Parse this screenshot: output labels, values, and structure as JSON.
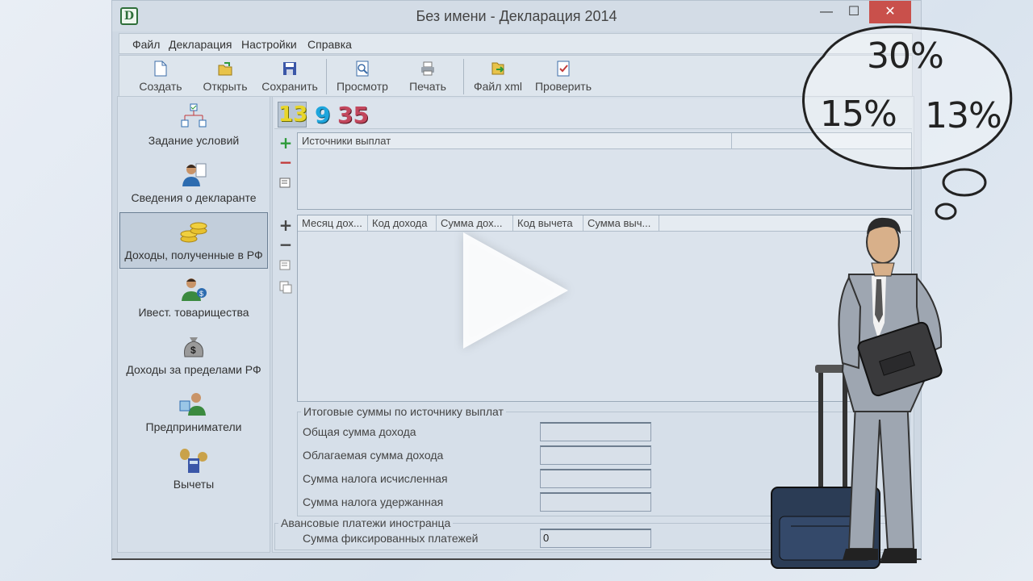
{
  "window": {
    "title": "Без имени - Декларация 2014",
    "app_icon": "D",
    "minimize": "—",
    "maximize": "☐",
    "close": "✕"
  },
  "menu": [
    "Файл",
    "Декларация",
    "Настройки",
    "Справка"
  ],
  "toolbar": [
    "Создать",
    "Открыть",
    "Сохранить",
    "Просмотр",
    "Печать",
    "Файл xml",
    "Проверить"
  ],
  "nav": [
    "Задание условий",
    "Сведения о декларанте",
    "Доходы, полученные в РФ",
    "Ивест. товарищества",
    "Доходы за пределами РФ",
    "Предприниматели",
    "Вычеты"
  ],
  "rates": [
    "13",
    "9",
    "35"
  ],
  "sources_grid": {
    "headers": [
      "Источники выплат",
      ""
    ]
  },
  "income_grid": {
    "headers": [
      "Месяц дох...",
      "Код дохода",
      "Сумма дох...",
      "Код вычета",
      "Сумма выч..."
    ]
  },
  "totals": {
    "title": "Итоговые суммы по источнику выплат",
    "labels": [
      "Общая сумма дохода",
      "Облагаемая сумма дохода",
      "Сумма налога исчисленная",
      "Сумма налога удержанная"
    ],
    "values": [
      "",
      "",
      "",
      ""
    ]
  },
  "advance": {
    "title": "Авансовые платежи иностранца",
    "label": "Сумма фиксированных платежей",
    "value": "0"
  },
  "thought_rates": [
    "30%",
    "15%",
    "13%"
  ],
  "colors": {
    "accent_close": "#c9504b",
    "rate13": "#e8d62b",
    "rate9": "#1ea5dc",
    "rate35": "#c2475d"
  }
}
